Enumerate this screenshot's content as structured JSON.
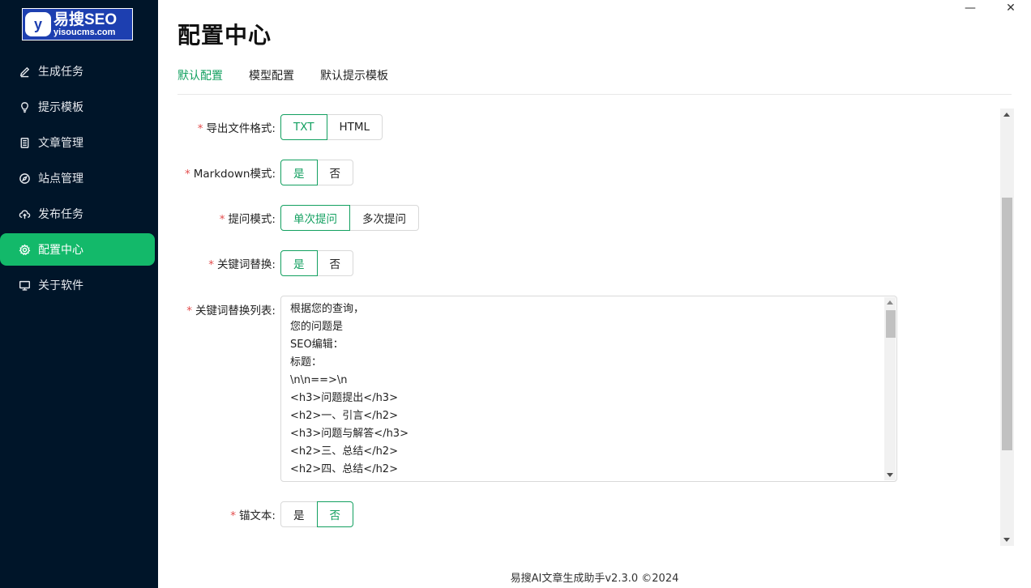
{
  "logo": {
    "badge": "y",
    "main": "易搜SEO",
    "sub": "yisoucms.com"
  },
  "sidebar": {
    "items": [
      {
        "label": "生成任务",
        "icon": "edit-icon"
      },
      {
        "label": "提示模板",
        "icon": "bulb-icon"
      },
      {
        "label": "文章管理",
        "icon": "document-icon"
      },
      {
        "label": "站点管理",
        "icon": "compass-icon"
      },
      {
        "label": "发布任务",
        "icon": "cloud-upload-icon"
      },
      {
        "label": "配置中心",
        "icon": "gear-icon",
        "active": true
      },
      {
        "label": "关于软件",
        "icon": "monitor-icon"
      }
    ]
  },
  "window": {
    "minimize": "—",
    "close": "✕"
  },
  "page": {
    "title": "配置中心"
  },
  "tabs": [
    {
      "label": "默认配置",
      "active": true
    },
    {
      "label": "模型配置"
    },
    {
      "label": "默认提示模板"
    }
  ],
  "form": {
    "export_format": {
      "label": "导出文件格式:",
      "options": [
        "TXT",
        "HTML"
      ],
      "selected": "TXT"
    },
    "markdown": {
      "label": "Markdown模式:",
      "options": [
        "是",
        "否"
      ],
      "selected": "是"
    },
    "ask_mode": {
      "label": "提问模式:",
      "options": [
        "单次提问",
        "多次提问"
      ],
      "selected": "单次提问"
    },
    "keyword_replace": {
      "label": "关键词替换:",
      "options": [
        "是",
        "否"
      ],
      "selected": "是"
    },
    "keyword_list": {
      "label": "关键词替换列表:",
      "lines": [
        "根据您的查询，",
        "您的问题是",
        "SEO编辑：",
        "标题：",
        "\\n\\n==>\\n",
        "<h3>问题提出</h3>",
        "<h2>一、引言</h2>",
        "<h3>问题与解答</h3>",
        "<h2>三、总结</h2>",
        "<h2>四、总结</h2>"
      ]
    },
    "anchor_text": {
      "label": "锚文本:",
      "options": [
        "是",
        "否"
      ],
      "selected": "否"
    }
  },
  "footer": "易搜AI文章生成助手v2.3.0 ©2024",
  "colors": {
    "sidebar_bg": "#001529",
    "accent": "#13b96a",
    "required": "#e34d4d"
  }
}
